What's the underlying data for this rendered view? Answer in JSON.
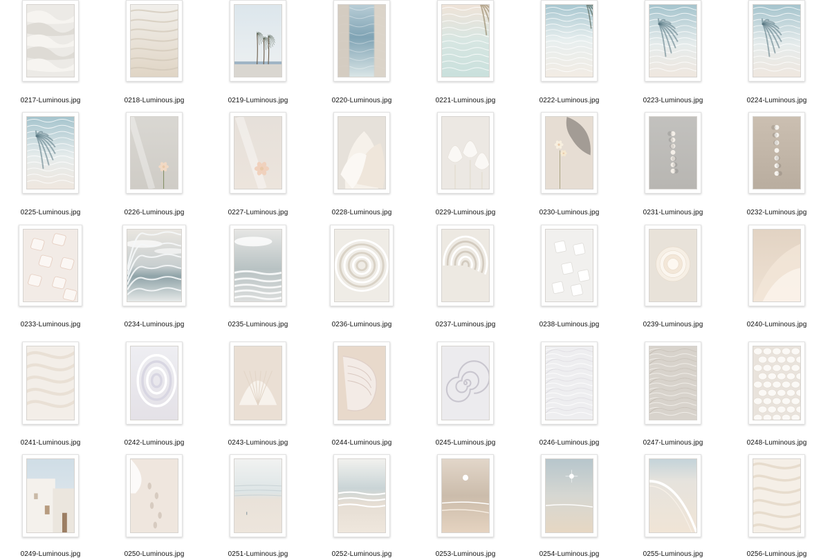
{
  "files": [
    {
      "name": "0217-Luminous.jpg",
      "scene": "sand-dunes"
    },
    {
      "name": "0218-Luminous.jpg",
      "scene": "sand-ripples"
    },
    {
      "name": "0219-Luminous.jpg",
      "scene": "palm-trees-sky"
    },
    {
      "name": "0220-Luminous.jpg",
      "scene": "window-sea"
    },
    {
      "name": "0221-Luminous.jpg",
      "scene": "palm-leaf-water"
    },
    {
      "name": "0222-Luminous.jpg",
      "scene": "pool-water-palm"
    },
    {
      "name": "0223-Luminous.jpg",
      "scene": "palm-shadow-water"
    },
    {
      "name": "0224-Luminous.jpg",
      "scene": "palm-shadow-water"
    },
    {
      "name": "0225-Luminous.jpg",
      "scene": "palm-shadow-water"
    },
    {
      "name": "0226-Luminous.jpg",
      "scene": "flower-wall"
    },
    {
      "name": "0227-Luminous.jpg",
      "scene": "flower-soft"
    },
    {
      "name": "0228-Luminous.jpg",
      "scene": "white-petals"
    },
    {
      "name": "0229-Luminous.jpg",
      "scene": "white-tulips"
    },
    {
      "name": "0230-Luminous.jpg",
      "scene": "orchid-shadow"
    },
    {
      "name": "0231-Luminous.jpg",
      "scene": "moon-phases-gray"
    },
    {
      "name": "0232-Luminous.jpg",
      "scene": "moon-phases-beige"
    },
    {
      "name": "0233-Luminous.jpg",
      "scene": "ice-cubes"
    },
    {
      "name": "0234-Luminous.jpg",
      "scene": "ocean-waves"
    },
    {
      "name": "0235-Luminous.jpg",
      "scene": "ocean-foam"
    },
    {
      "name": "0236-Luminous.jpg",
      "scene": "water-rings"
    },
    {
      "name": "0237-Luminous.jpg",
      "scene": "water-swirl"
    },
    {
      "name": "0238-Luminous.jpg",
      "scene": "ice-cubes-white"
    },
    {
      "name": "0239-Luminous.jpg",
      "scene": "white-peony"
    },
    {
      "name": "0240-Luminous.jpg",
      "scene": "petal-macro"
    },
    {
      "name": "0241-Luminous.jpg",
      "scene": "silk-drape"
    },
    {
      "name": "0242-Luminous.jpg",
      "scene": "pearl-shell"
    },
    {
      "name": "0243-Luminous.jpg",
      "scene": "scallop-shell"
    },
    {
      "name": "0244-Luminous.jpg",
      "scene": "shell-curve"
    },
    {
      "name": "0245-Luminous.jpg",
      "scene": "nautilus-shell"
    },
    {
      "name": "0246-Luminous.jpg",
      "scene": "water-caustics"
    },
    {
      "name": "0247-Luminous.jpg",
      "scene": "water-caustics-gray"
    },
    {
      "name": "0248-Luminous.jpg",
      "scene": "white-discs"
    },
    {
      "name": "0249-Luminous.jpg",
      "scene": "white-buildings"
    },
    {
      "name": "0250-Luminous.jpg",
      "scene": "footprints-sand"
    },
    {
      "name": "0251-Luminous.jpg",
      "scene": "beach-shore"
    },
    {
      "name": "0252-Luminous.jpg",
      "scene": "beach-waves"
    },
    {
      "name": "0253-Luminous.jpg",
      "scene": "sunset-beach"
    },
    {
      "name": "0254-Luminous.jpg",
      "scene": "sunset-beach-blue"
    },
    {
      "name": "0255-Luminous.jpg",
      "scene": "beach-wave-curve"
    },
    {
      "name": "0256-Luminous.jpg",
      "scene": "cream-texture"
    }
  ]
}
